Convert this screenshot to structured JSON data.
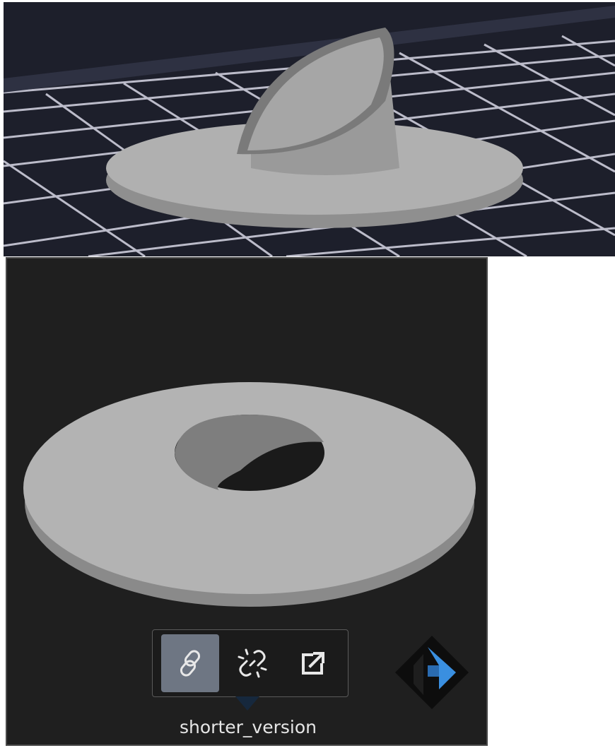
{
  "preview": {
    "file_name": "shorter_version"
  },
  "toolbar": {
    "buttons": [
      {
        "icon": "link-icon",
        "state": "active"
      },
      {
        "icon": "unlink-icon",
        "state": "inactive"
      },
      {
        "icon": "open-external-icon",
        "state": "inactive"
      }
    ]
  },
  "colors": {
    "viewport_bg": "#1d1f2b",
    "grid_line": "#d8d8e6",
    "model_gray": "#b4b4b4",
    "card_bg": "#1f1f1f",
    "active_button": "#6e7683",
    "logo_blue": "#3a8fe0"
  }
}
